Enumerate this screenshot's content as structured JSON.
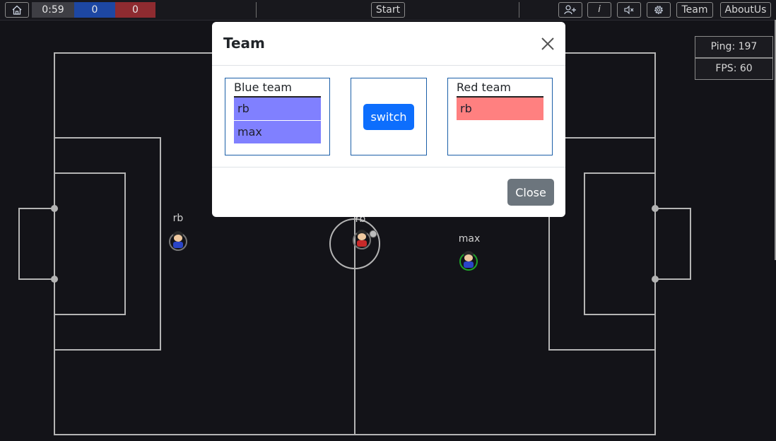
{
  "topbar": {
    "timer": "0:59",
    "blue_score": "0",
    "red_score": "0",
    "start_label": "Start",
    "team_label": "Team",
    "aboutus_label": "AboutUs",
    "info_label": "i",
    "icons": [
      "home-icon",
      "add-user-icon",
      "info-icon",
      "mute-icon",
      "gear-icon"
    ]
  },
  "stats": {
    "ping": "Ping: 197",
    "fps": "FPS: 60"
  },
  "players": [
    {
      "name": "rb",
      "team": "blue"
    },
    {
      "name": "rb",
      "team": "red"
    },
    {
      "name": "max",
      "team": "blue"
    }
  ],
  "modal": {
    "title": "Team",
    "blue_team": {
      "title": "Blue team",
      "members": [
        "rb",
        "max"
      ]
    },
    "red_team": {
      "title": "Red team",
      "members": [
        "rb"
      ]
    },
    "switch_label": "switch",
    "close_label": "Close"
  },
  "colors": {
    "background": "#131318",
    "field_lines": "#b4b4b4",
    "blue_score_bg": "#1d47a3",
    "red_score_bg": "#8e2b30",
    "blue_member": "#8080ff",
    "red_member": "#ff8080",
    "switch_button": "#0d6efd",
    "close_button": "#6c757d"
  }
}
